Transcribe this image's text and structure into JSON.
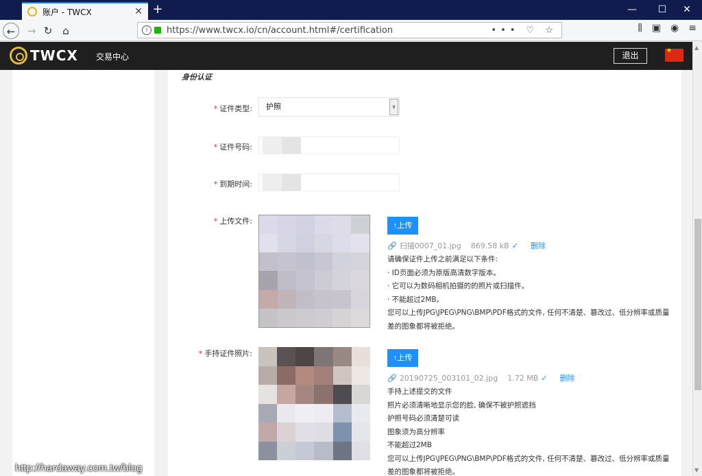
{
  "browser": {
    "tab_title": "账户 - TWCX",
    "tab_close": "✕",
    "new_tab": "+",
    "url": "https://www.twcx.io/cn/account.html#/certification",
    "url_actions": "••• ♡ ☆",
    "win_min": "—",
    "win_max": "☐",
    "win_close": "✕"
  },
  "header": {
    "logo_text": "TWCX",
    "nav_exchange": "交易中心",
    "logout": "退出"
  },
  "form": {
    "section_title": "身份认证",
    "required_mark": "*",
    "id_type_label": "证件类型:",
    "id_type_value": "护照",
    "id_number_label": "证件号码:",
    "expiry_label": "到期时间:",
    "upload_label": "上传文件:",
    "handheld_label": "手持证件照片:",
    "upload_button": "↑上传"
  },
  "file1": {
    "name": "扫描0007_01.jpg",
    "size": "869.58 kB",
    "delete": "删除",
    "notes": [
      "请确保证件上传之前满足以下条件:",
      "· ID页面必须为原版高清数字版本。",
      "· 它可以为数码相机拍摄的的照片或扫描件。",
      "· 不能超过2MB。",
      "您可以上传JPG\\JPEG\\PNG\\BMP\\PDF格式的文件, 任何不清楚、篡改过、低分辨率或质量差的图象都将被拒绝。"
    ]
  },
  "file2": {
    "name": "20190725_003101_02.jpg",
    "size": "1.72 MB",
    "delete": "删除",
    "notes": [
      "手持上述提交的文件",
      "照片必须清晰地显示您的脸, 确保不被护照遮挡",
      "护照号码必须清楚可读",
      "图象须为高分辨率",
      "不能超过2MB",
      "您可以上传JPG\\JPEG\\PNG\\BMP\\PDF格式的文件, 任何不清楚、篡改过、低分辨率或质量差的图象都将被拒绝。"
    ]
  },
  "watermark": "http://hardaway.com.tw/blog",
  "colors": {
    "accent": "#1e90ff",
    "required": "#ee2233",
    "header_bg": "#1f1f1f",
    "logo_gold": "#e5b93b",
    "tabbar_bg": "#0f1c4d"
  },
  "photo1_tiles": [
    "#ddd9e8",
    "#d8d6e6",
    "#d3d2e3",
    "#dcdae8",
    "#dedce9",
    "#cfcfd6",
    "#e1e0ec",
    "#d6d6e4",
    "#d0d1e0",
    "#d7d6e3",
    "#dddcea",
    "#e3e2ec",
    "#c3c0cc",
    "#c6c3d0",
    "#c1c0ce",
    "#c8c6d2",
    "#d1d2dc",
    "#d5d4dd",
    "#a8a2ac",
    "#c0bcc8",
    "#c4c3cf",
    "#cccbd6",
    "#d4d3dc",
    "#dad8de",
    "#c4aaa8",
    "#c1b4b9",
    "#c2bdc8",
    "#c6c3cc",
    "#c7c4cf",
    "#d8d6dc",
    "#c6c3c6",
    "#cbc8cb",
    "#cdcbcf",
    "#cfcdd1",
    "#d6d3d4",
    "#dcdadb"
  ],
  "photo2_tiles": [
    "#cac2bd",
    "#5a5253",
    "#4d4546",
    "#7e7676",
    "#9a8983",
    "#e8dfdb",
    "#b7aca8",
    "#8c6b66",
    "#b28a82",
    "#a27f78",
    "#cfc6c2",
    "#ebe8e6",
    "#e6e2e0",
    "#c7a6a2",
    "#a58680",
    "#8c726f",
    "#4e4c50",
    "#d9d6d6",
    "#a7aab5",
    "#eae8ef",
    "#f0eff3",
    "#eeecf2",
    "#b5bccb",
    "#e9eaee",
    "#c1a9aa",
    "#dcd2d6",
    "#e0dfe7",
    "#dfdde4",
    "#7e91ad",
    "#e5e6ea",
    "#8d919d",
    "#cdcfd6",
    "#c5c9d6",
    "#b8bcc9",
    "#6d7585",
    "#e0e0e4"
  ]
}
